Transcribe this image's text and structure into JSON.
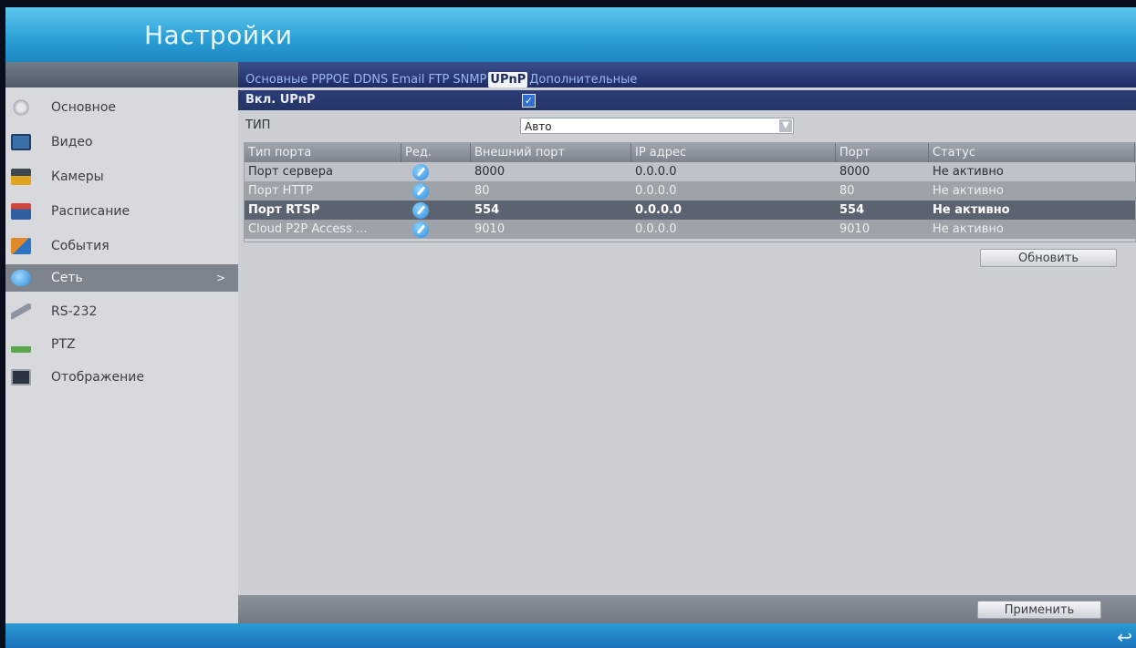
{
  "header": {
    "title": "Настройки"
  },
  "sidebar": {
    "items": [
      {
        "label": "Основное",
        "icon": "gear-icon",
        "color": "#b9bcc1"
      },
      {
        "label": "Видео",
        "icon": "monitor-icon",
        "color": "#3b6fa8"
      },
      {
        "label": "Камеры",
        "icon": "camera-icon",
        "color": "#e1a41f"
      },
      {
        "label": "Расписание",
        "icon": "calendar-icon",
        "color": "#d2453a"
      },
      {
        "label": "События",
        "icon": "event-icon",
        "color": "#e08a2a"
      },
      {
        "label": "Сеть",
        "icon": "network-icon",
        "color": "#2f8fd8",
        "active": true,
        "arrow": ">"
      },
      {
        "label": "RS-232",
        "icon": "rs232-icon",
        "color": "#8d96a0"
      },
      {
        "label": "PTZ",
        "icon": "ptz-icon",
        "color": "#5aa64a"
      },
      {
        "label": "Отображение",
        "icon": "display-icon",
        "color": "#2c3440"
      }
    ]
  },
  "tabs": [
    "Основные",
    "PPPOE",
    "DDNS",
    "Email",
    "FTP",
    "SNMP",
    "UPnP",
    "Дополнительные"
  ],
  "active_tab": "UPnP",
  "upnp": {
    "enable_label": "Вкл. UPnP",
    "enabled": true,
    "type_label": "ТИП",
    "type_value": "Авто"
  },
  "table": {
    "headers": [
      "Тип порта",
      "Ред.",
      "Внешний порт",
      "IP адрес",
      "Порт",
      "Статус"
    ],
    "rows": [
      [
        "Порт сервера",
        "",
        "8000",
        "0.0.0.0",
        "8000",
        "Не активно"
      ],
      [
        "Порт HTTP",
        "",
        "80",
        "0.0.0.0",
        "80",
        "Не активно"
      ],
      [
        "Порт RTSP",
        "",
        "554",
        "0.0.0.0",
        "554",
        "Не активно"
      ],
      [
        "Cloud P2P Access ...",
        "",
        "9010",
        "0.0.0.0",
        "9010",
        "Не активно"
      ]
    ]
  },
  "buttons": {
    "refresh": "Обновить",
    "apply": "Применить"
  },
  "footer": {
    "back_icon": "↩"
  }
}
